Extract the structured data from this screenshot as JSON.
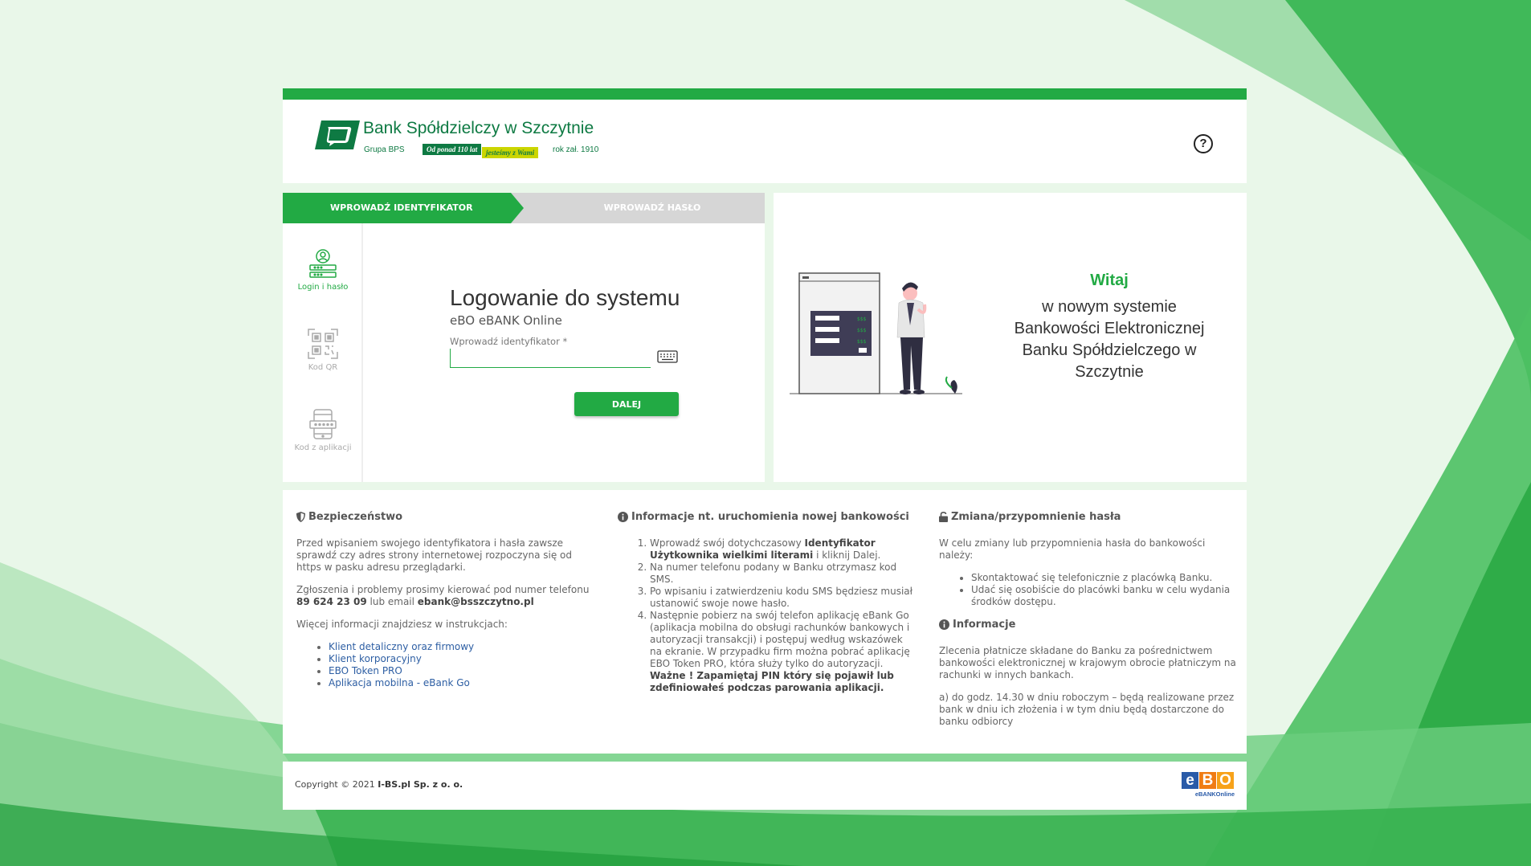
{
  "header": {
    "bank_name": "Bank Spółdzielczy w Szczytnie",
    "group": "Grupa BPS",
    "founded": "rok zał. 1910",
    "slogan_1": "Od ponad 110 lat",
    "slogan_2": "jesteśmy z Wami",
    "help_glyph": "?",
    "icons": {
      "help": "help-circle-icon",
      "logo": "bank-logo-icon"
    }
  },
  "steps": {
    "active": "WPROWADŹ IDENTYFIKATOR",
    "inactive": "WPROWADŹ HASŁO"
  },
  "methods": [
    {
      "label": "Login i hasło",
      "active": true,
      "icon": "user-login-icon"
    },
    {
      "label": "Kod QR",
      "active": false,
      "icon": "qr-code-icon"
    },
    {
      "label": "Kod z aplikacji",
      "active": false,
      "icon": "phone-app-icon"
    }
  ],
  "login": {
    "title": "Logowanie do systemu",
    "subtitle": "eBO eBANK Online",
    "field_label": "Wprowadź identyfikator *",
    "field_value": "",
    "keyboard_icon": "virtual-keyboard-icon",
    "next_button": "DALEJ"
  },
  "welcome": {
    "greeting": "Witaj",
    "lines": [
      "w nowym systemie",
      "Bankowości Elektronicznej",
      "Banku Spółdzielczego w",
      "Szczytnie"
    ]
  },
  "security": {
    "title": "Bezpieczeństwo",
    "icon": "shield-icon",
    "p1": "Przed wpisaniem swojego identyfikatora i hasła zawsze sprawdź czy adres strony internetowej rozpoczyna się od https w pasku adresu przeglądarki.",
    "p2_a": "Zgłoszenia i problemy prosimy kierować pod numer telefonu ",
    "phone": "89 624 23 09",
    "p2_b": " lub email ",
    "email": "ebank@bsszczytno.pl",
    "p3": "Więcej informacji znajdziesz w instrukcjach:",
    "links": [
      "Klient detaliczny oraz firmowy",
      "Klient korporacyjny",
      "EBO Token PRO",
      "Aplikacja mobilna - eBank Go"
    ]
  },
  "launch_info": {
    "title": "Informacje nt. uruchomienia nowej bankowości",
    "icon": "info-circle-icon",
    "step1_a": "Wprowadź swój dotychczasowy ",
    "step1_b": "Identyfikator Użytkownika wielkimi literami",
    "step1_c": " i kliknij Dalej.",
    "step2": "Na numer telefonu podany w Banku otrzymasz kod SMS.",
    "step3": "Po wpisaniu i zatwierdzeniu kodu SMS będziesz musiał ustanowić swoje nowe hasło.",
    "step4": "Następnie pobierz na swój telefon aplikację eBank Go (aplikacja mobilna do obsługi rachunków bankowych i autoryzacji transakcji) i postępuj według wskazówek na ekranie. W przypadku firm można pobrać aplikację EBO Token PRO, która służy tylko do autoryzacji.",
    "step4_bold": "Ważne ! Zapamiętaj PIN który się pojawił lub zdefiniowałeś podczas parowania aplikacji."
  },
  "password": {
    "title": "Zmiana/przypomnienie hasła",
    "icon": "lock-icon",
    "intro": "W celu zmiany lub przypomnienia hasła do bankowości należy:",
    "items": [
      "Skontaktować się telefonicznie z placówką Banku.",
      "Udać się osobiście do placówki banku w celu wydania środków dostępu."
    ],
    "info_title": "Informacje",
    "info_icon": "info-circle-icon",
    "info_p1": "Zlecenia płatnicze składane do Banku za pośrednictwem bankowości elektronicznej w krajowym obrocie płatniczym na rachunki w innych bankach.",
    "info_p2": "a) do godz. 14.30 w dniu roboczym – będą realizowane przez bank w dniu ich złożenia i w tym dniu będą dostarczone do banku odbiorcy"
  },
  "footer": {
    "copyright": "Copyright © 2021 ",
    "company": "I-BS.pl Sp. z o. o.",
    "ebo_letters": [
      "e",
      "B",
      "O"
    ],
    "ebo_sub": "eBANKOnline"
  },
  "colors": {
    "accent": "#22aa44",
    "brand": "#0e7a43",
    "link": "#2d5ea3",
    "inactive_step": "#d6d6d6"
  }
}
